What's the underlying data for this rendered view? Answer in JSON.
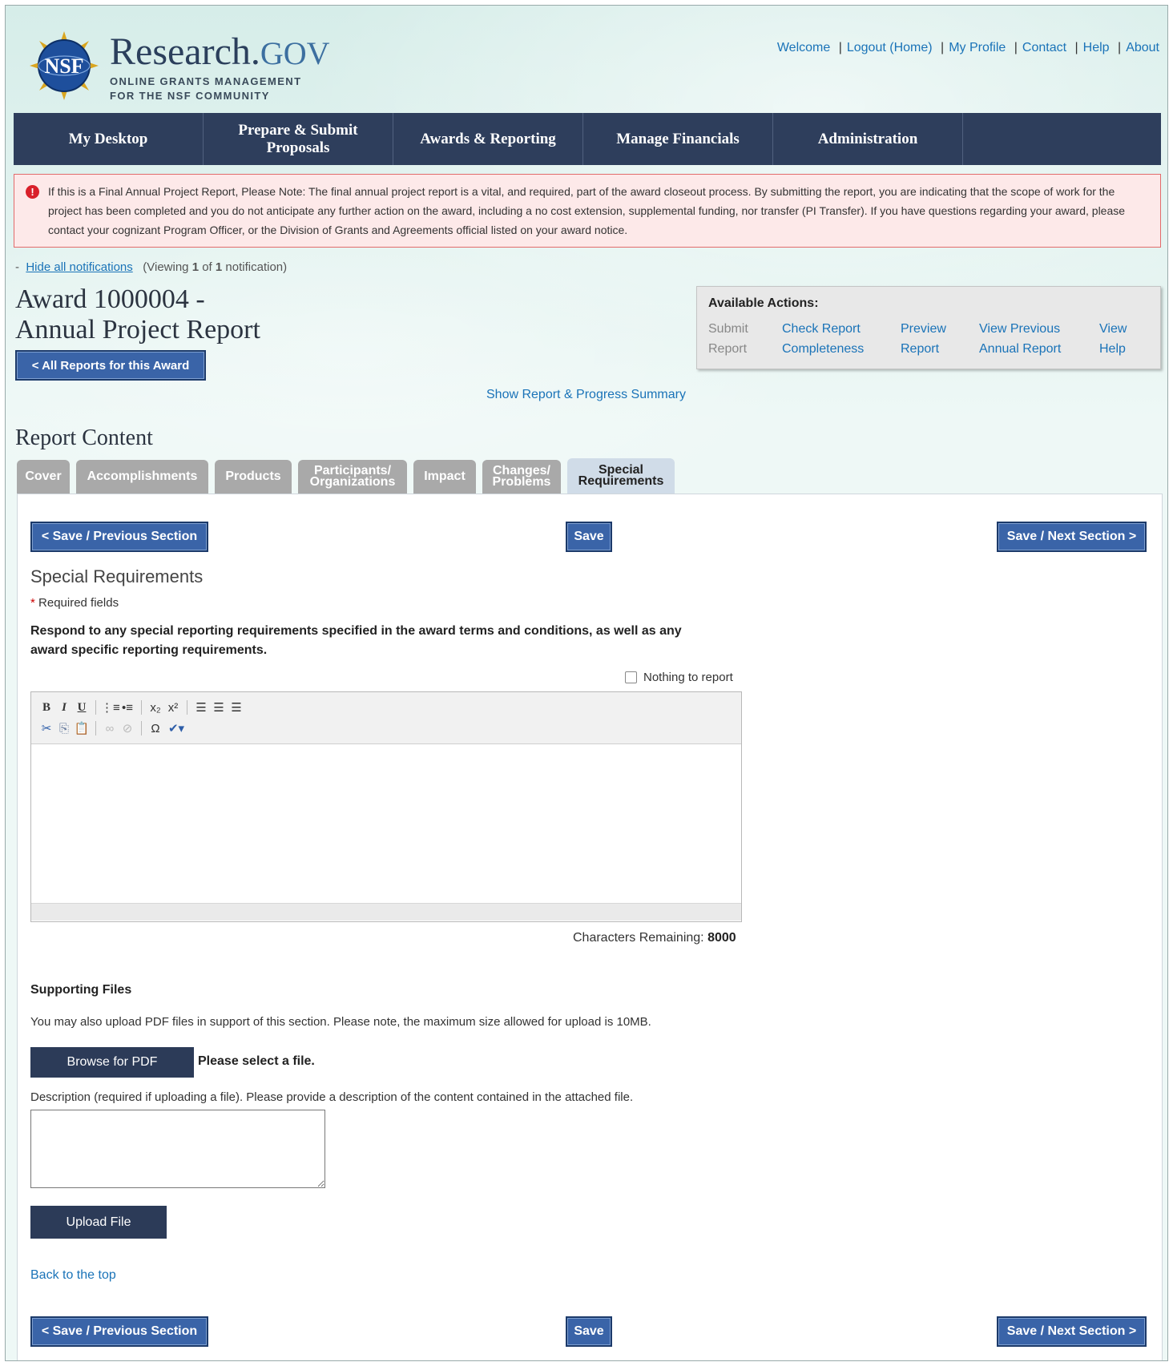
{
  "header": {
    "brand_main": "Research.",
    "brand_gov": "GOV",
    "brand_sub1": "ONLINE GRANTS MANAGEMENT",
    "brand_sub2": "FOR THE NSF COMMUNITY",
    "seal_text": "NSF",
    "links": {
      "welcome": "Welcome",
      "logout": "Logout (Home)",
      "profile": "My Profile",
      "contact": "Contact",
      "help": "Help",
      "about": "About"
    }
  },
  "nav": {
    "items": [
      "My Desktop",
      "Prepare & Submit Proposals",
      "Awards & Reporting",
      "Manage Financials",
      "Administration"
    ]
  },
  "alert": {
    "icon": "!",
    "text": "If this is a Final Annual Project Report, Please Note: The final annual project report is a vital, and required, part of the award closeout process. By submitting the report, you are indicating that the scope of work for the project has been completed and you do not anticipate any further action on the award, including a no cost extension, supplemental funding, nor transfer (PI Transfer). If you have questions regarding your award, please contact your cognizant Program Officer, or the Division of Grants and Agreements official listed on your award notice."
  },
  "notifications": {
    "dash": "-",
    "hide_label": "Hide all notifications",
    "viewing_prefix": "(Viewing",
    "current": "1",
    "of": "of",
    "total": "1",
    "suffix": "notification)"
  },
  "page": {
    "title_line1": "Award 1000004 -",
    "title_line2": "Annual Project Report",
    "all_reports_button": "< All Reports for this Award",
    "show_summary": "Show Report & Progress Summary",
    "report_content": "Report Content"
  },
  "actions": {
    "title": "Available Actions:",
    "items": [
      {
        "line1": "Submit",
        "line2": "Report",
        "enabled": false
      },
      {
        "line1": "Check Report",
        "line2": "Completeness",
        "enabled": true
      },
      {
        "line1": "Preview",
        "line2": "Report",
        "enabled": true
      },
      {
        "line1": "View Previous",
        "line2": "Annual Report",
        "enabled": true
      },
      {
        "line1": "View",
        "line2": "Help",
        "enabled": true
      }
    ]
  },
  "tabs": [
    {
      "line1": "Cover",
      "line2": ""
    },
    {
      "line1": "Accomplishments",
      "line2": ""
    },
    {
      "line1": "Products",
      "line2": ""
    },
    {
      "line1": "Participants/",
      "line2": "Organizations"
    },
    {
      "line1": "Impact",
      "line2": ""
    },
    {
      "line1": "Changes/",
      "line2": "Problems"
    },
    {
      "line1": "Special",
      "line2": "Requirements",
      "active": true
    }
  ],
  "section": {
    "prev_button": "< Save / Previous Section",
    "save_button": "Save",
    "next_button": "Save / Next Section >",
    "title": "Special Requirements",
    "required_star": "*",
    "required_text": "Required fields",
    "instruction": "Respond to any special reporting requirements specified in the award terms and conditions, as well as any award specific reporting requirements.",
    "nothing_to_report": "Nothing to report",
    "chars_label": "Characters Remaining:",
    "chars_value": "8000"
  },
  "editor": {
    "row1": [
      "B",
      "I",
      "U",
      "|",
      "ordered-list-icon",
      "bulleted-list-icon",
      "|",
      "subscript-icon",
      "superscript-icon",
      "|",
      "align-left-icon",
      "align-center-icon",
      "align-right-icon"
    ],
    "row2": [
      "cut-icon",
      "copy-icon",
      "paste-icon",
      "|",
      "link-icon",
      "unlink-icon",
      "|",
      "special-char-icon",
      "spellcheck-icon"
    ]
  },
  "supporting": {
    "title": "Supporting Files",
    "text": "You may also upload PDF files in support of this section. Please note, the maximum size allowed for upload is 10MB.",
    "browse_button": "Browse for PDF",
    "file_status": "Please select a file.",
    "desc_label": "Description (required if uploading a file). Please provide a description of the content contained in the attached file.",
    "upload_button": "Upload File",
    "back_to_top": "Back to the top"
  },
  "colors": {
    "nav_bg": "#2e3e5c",
    "link": "#1a73b8",
    "button_blue": "#3a64a8",
    "alert_border": "#e26b6b",
    "alert_bg": "#fde9e9"
  }
}
